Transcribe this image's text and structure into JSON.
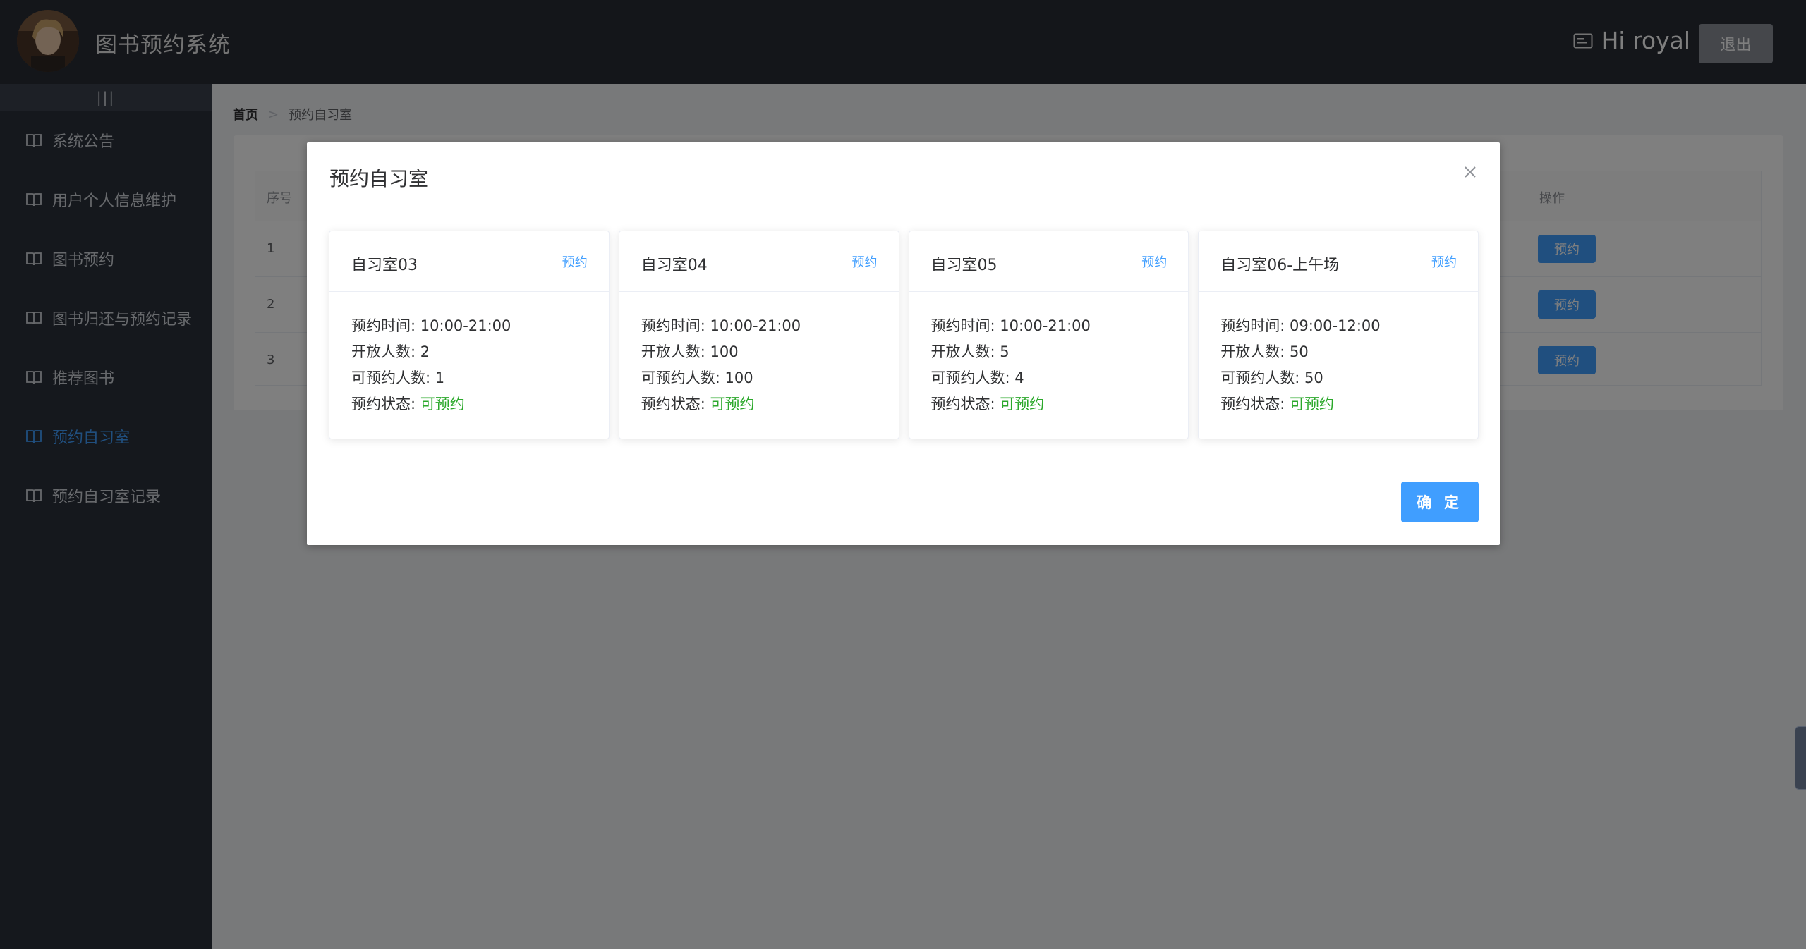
{
  "header": {
    "app_title": "图书预约系统",
    "greeting": "Hi royal",
    "logout_label": "退出"
  },
  "sidebar": {
    "collapse_label": "|||",
    "items": [
      {
        "label": "系统公告",
        "active": false
      },
      {
        "label": "用户个人信息维护",
        "active": false
      },
      {
        "label": "图书预约",
        "active": false
      },
      {
        "label": "图书归还与预约记录",
        "active": false
      },
      {
        "label": "推荐图书",
        "active": false
      },
      {
        "label": "预约自习室",
        "active": true
      },
      {
        "label": "预约自习室记录",
        "active": false
      }
    ]
  },
  "breadcrumb": {
    "home": "首页",
    "separator": ">",
    "current": "预约自习室"
  },
  "table": {
    "col_index": "序号",
    "col_action": "操作",
    "rows": [
      {
        "index": "1",
        "action": "预约"
      },
      {
        "index": "2",
        "action": "预约"
      },
      {
        "index": "3",
        "action": "预约"
      }
    ]
  },
  "dialog": {
    "title": "预约自习室",
    "confirm_label": "确 定",
    "labels": {
      "time": "预约时间: ",
      "capacity": "开放人数: ",
      "available": "可预约人数: ",
      "status": "预约状态: "
    },
    "rooms": [
      {
        "name": "自习室03",
        "reserve": "预约",
        "time": "10:00-21:00",
        "capacity": "2",
        "available": "1",
        "status": "可预约"
      },
      {
        "name": "自习室04",
        "reserve": "预约",
        "time": "10:00-21:00",
        "capacity": "100",
        "available": "100",
        "status": "可预约"
      },
      {
        "name": "自习室05",
        "reserve": "预约",
        "time": "10:00-21:00",
        "capacity": "5",
        "available": "4",
        "status": "可预约"
      },
      {
        "name": "自习室06-上午场",
        "reserve": "预约",
        "time": "09:00-12:00",
        "capacity": "50",
        "available": "50",
        "status": "可预约"
      }
    ]
  },
  "colors": {
    "header_bg": "#282d35",
    "sidebar_bg": "#2b313b",
    "accent": "#409eff",
    "status_ok": "#2ba82b"
  }
}
